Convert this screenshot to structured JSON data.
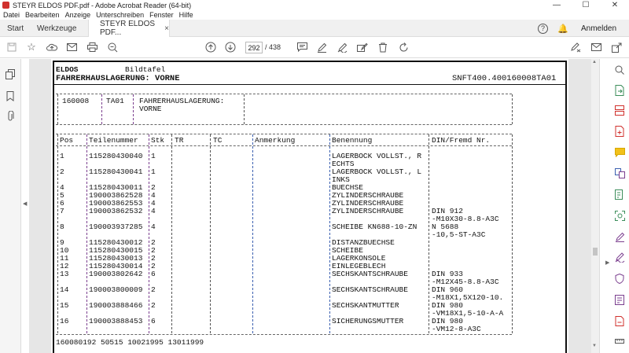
{
  "window": {
    "title": "STEYR ELDOS PDF.pdf - Adobe Acrobat Reader (64-bit)",
    "minimize": "—",
    "maximize": "☐",
    "close": "✕"
  },
  "menu": [
    "Datei",
    "Bearbeiten",
    "Anzeige",
    "Unterschreiben",
    "Fenster",
    "Hilfe"
  ],
  "tabs": {
    "start": "Start",
    "tools": "Werkzeuge",
    "document": "STEYR ELDOS PDF...",
    "document_close": "×",
    "signin": "Anmelden"
  },
  "toolbar": {
    "page_current": "292",
    "page_total": "/ 438"
  },
  "doc": {
    "header_left": "ELDOS",
    "header_left2": "Bildtafel",
    "title": "FAHRERHAUSLAGERUNG: VORNE",
    "code": "SNFT400.400160008TA01",
    "info": {
      "id": "160008",
      "ta": "TA01",
      "desc1": "FAHRERHAUSLAGERUNG:",
      "desc2": "VORNE"
    },
    "columns": [
      "Pos",
      "Teilenummer",
      "Stk",
      "TR",
      "TC",
      "Anmerkung",
      "Benennung",
      "DIN/Fremd Nr."
    ],
    "rows": [
      {
        "pos": "1",
        "teil": "115280430040",
        "stk": "1",
        "ben": "LAGERBOCK VOLLST., R",
        "ben2": "ECHTS",
        "din": "",
        "din2": ""
      },
      {
        "pos": "2",
        "teil": "115280430041",
        "stk": "1",
        "ben": "LAGERBOCK VOLLST., L",
        "ben2": "INKS",
        "din": "",
        "din2": ""
      },
      {
        "pos": "4",
        "teil": "115280430011",
        "stk": "2",
        "ben": "BUECHSE",
        "ben2": "",
        "din": "",
        "din2": ""
      },
      {
        "pos": "5",
        "teil": "190003862528",
        "stk": "4",
        "ben": "ZYLINDERSCHRAUBE",
        "ben2": "",
        "din": "",
        "din2": ""
      },
      {
        "pos": "6",
        "teil": "190003862553",
        "stk": "4",
        "ben": "ZYLINDERSCHRAUBE",
        "ben2": "",
        "din": "",
        "din2": ""
      },
      {
        "pos": "7",
        "teil": "190003862532",
        "stk": "4",
        "ben": "ZYLINDERSCHRAUBE",
        "ben2": "",
        "din": "DIN 912",
        "din2": "-M10X30-8.8-A3C"
      },
      {
        "pos": "8",
        "teil": "190003937285",
        "stk": "4",
        "ben": "SCHEIBE KN688-10-ZN",
        "ben2": "",
        "din": "N 5688",
        "din2": "-10,5-ST-A3C"
      },
      {
        "pos": "9",
        "teil": "115280430012",
        "stk": "2",
        "ben": "DISTANZBUECHSE",
        "ben2": "",
        "din": "",
        "din2": ""
      },
      {
        "pos": "10",
        "teil": "115280430015",
        "stk": "2",
        "ben": "SCHEIBE",
        "ben2": "",
        "din": "",
        "din2": ""
      },
      {
        "pos": "11",
        "teil": "115280430013",
        "stk": "2",
        "ben": "LAGERKONSOLE",
        "ben2": "",
        "din": "",
        "din2": ""
      },
      {
        "pos": "12",
        "teil": "115280430014",
        "stk": "2",
        "ben": "EINLEGEBLECH",
        "ben2": "",
        "din": "",
        "din2": ""
      },
      {
        "pos": "13",
        "teil": "190003802642",
        "stk": "6",
        "ben": "SECHSKANTSCHRAUBE",
        "ben2": "",
        "din": "DIN 933",
        "din2": "-M12X45-8.8-A3C"
      },
      {
        "pos": "14",
        "teil": "190003800009",
        "stk": "2",
        "ben": "SECHSKANTSCHRAUBE",
        "ben2": "",
        "din": "DIN 960",
        "din2": "-M18X1,5X120-10."
      },
      {
        "pos": "15",
        "teil": "190003888466",
        "stk": "2",
        "ben": "SECHSKANTMUTTER",
        "ben2": "",
        "din": "DIN 980",
        "din2": "-VM18X1,5-10-A-A"
      },
      {
        "pos": "16",
        "teil": "190003888453",
        "stk": "6",
        "ben": "SICHERUNGSMUTTER",
        "ben2": "",
        "din": "DIN 980",
        "din2": "-VM12-8-A3C"
      }
    ],
    "footer": "160080192 50515 10021995 13011999"
  }
}
